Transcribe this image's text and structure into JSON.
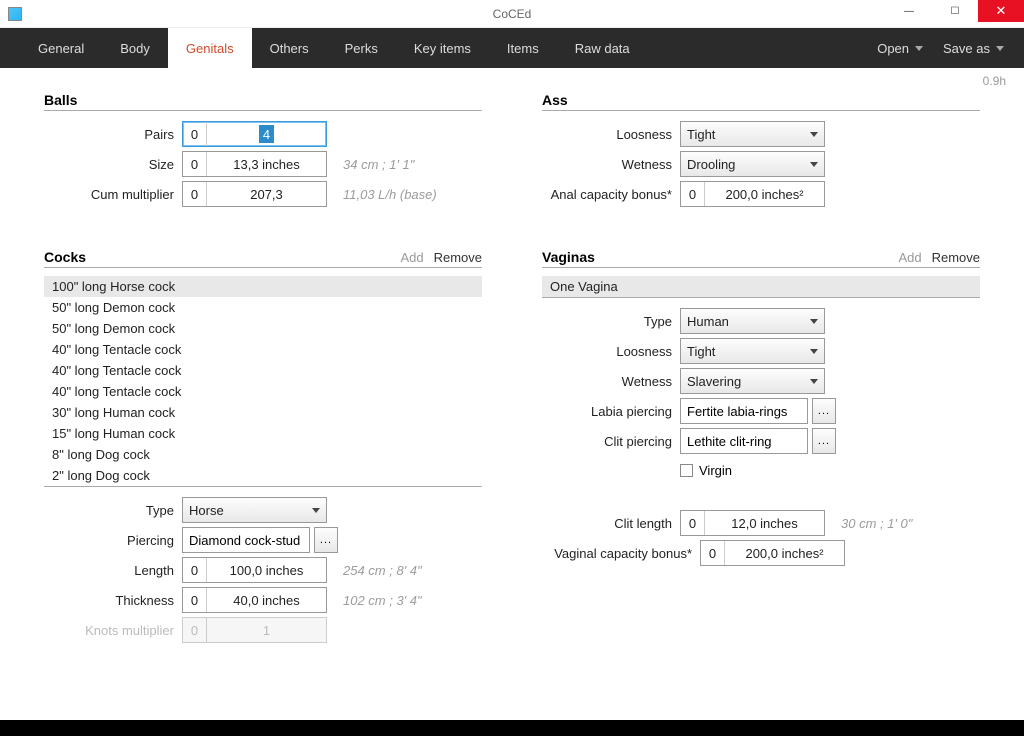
{
  "window": {
    "title": "CoCEd",
    "min": "—",
    "max": "☐",
    "close": "✕"
  },
  "version": "0.9h",
  "tabs": [
    "General",
    "Body",
    "Genitals",
    "Others",
    "Perks",
    "Key items",
    "Items",
    "Raw data"
  ],
  "active_tab": "Genitals",
  "nav": {
    "open": "Open",
    "save": "Save as"
  },
  "balls": {
    "title": "Balls",
    "pairs_label": "Pairs",
    "pairs_prefix": "0",
    "pairs_val": "4",
    "size_label": "Size",
    "size_prefix": "0",
    "size_val": "13,3 inches",
    "size_hint": "34 cm ; 1' 1\"",
    "cum_label": "Cum multiplier",
    "cum_prefix": "0",
    "cum_val": "207,3",
    "cum_hint": "11,03 L/h (base)"
  },
  "cocks": {
    "title": "Cocks",
    "add": "Add",
    "remove": "Remove",
    "items": [
      "100\" long Horse cock",
      "50\" long Demon cock",
      "50\" long Demon cock",
      "40\" long Tentacle cock",
      "40\" long Tentacle cock",
      "40\" long Tentacle cock",
      "30\" long Human cock",
      "15\" long Human cock",
      "8\" long Dog cock",
      "2\" long Dog cock"
    ],
    "type_label": "Type",
    "type_val": "Horse",
    "pierce_label": "Piercing",
    "pierce_val": "Diamond cock-stud",
    "length_label": "Length",
    "length_prefix": "0",
    "length_val": "100,0 inches",
    "length_hint": "254 cm ; 8' 4\"",
    "thick_label": "Thickness",
    "thick_prefix": "0",
    "thick_val": "40,0 inches",
    "thick_hint": "102 cm ; 3' 4\"",
    "knot_label": "Knots multiplier",
    "knot_prefix": "0",
    "knot_val": "1"
  },
  "ass": {
    "title": "Ass",
    "loose_label": "Loosness",
    "loose_val": "Tight",
    "wet_label": "Wetness",
    "wet_val": "Drooling",
    "cap_label": "Anal capacity bonus*",
    "cap_prefix": "0",
    "cap_val": "200,0 inches²"
  },
  "vaginas": {
    "title": "Vaginas",
    "add": "Add",
    "remove": "Remove",
    "items": [
      "One Vagina"
    ],
    "type_label": "Type",
    "type_val": "Human",
    "loose_label": "Loosness",
    "loose_val": "Tight",
    "wet_label": "Wetness",
    "wet_val": "Slavering",
    "labia_label": "Labia piercing",
    "labia_val": "Fertite labia-rings",
    "clitp_label": "Clit piercing",
    "clitp_val": "Lethite clit-ring",
    "virgin_label": "Virgin",
    "clitlen_label": "Clit length",
    "clitlen_prefix": "0",
    "clitlen_val": "12,0 inches",
    "clitlen_hint": "30 cm ; 1' 0\"",
    "cap_label": "Vaginal capacity bonus*",
    "cap_prefix": "0",
    "cap_val": "200,0 inches²"
  }
}
